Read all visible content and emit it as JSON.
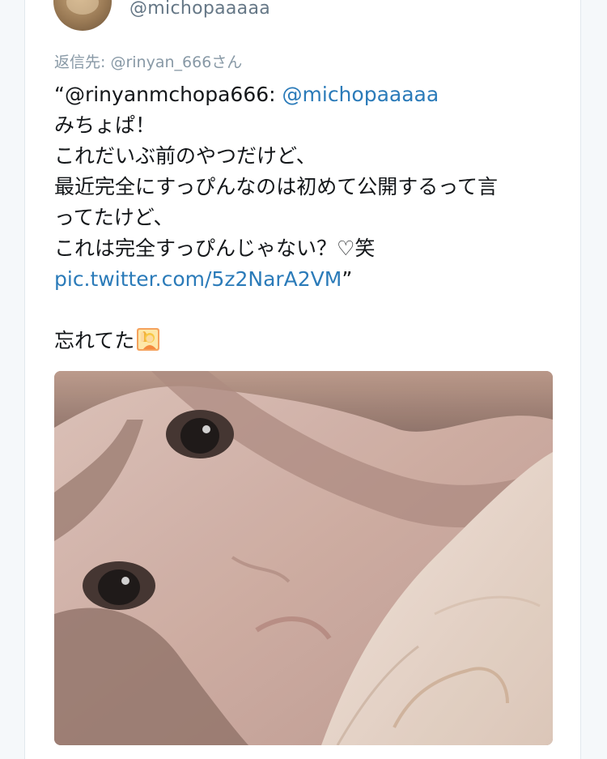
{
  "tweet": {
    "author_handle": "@michopaaaaa",
    "reply_to_label": "返信先:",
    "reply_to_user": "@rinyan_666さん",
    "quote_open": "“@rinyanmchopa666:",
    "quote_mention": "@michopaaaaa",
    "lines": [
      "みちょぱ！",
      "これだいぶ前のやつだけど、",
      "最近完全にすっぴんなのは初めて公開するって言",
      "ってたけど、",
      "これは完全すっぴんじゃない？♡笑"
    ],
    "quote_link": "pic.twitter.com/5z2NarA2VM",
    "quote_close": "”",
    "reply_text": "忘れてた"
  },
  "icons": {
    "avatar": "avatar-photo",
    "emoji": "person-raising-hand-emoji"
  },
  "colors": {
    "link": "#2b7bb9",
    "text": "#14171a",
    "muted": "#8899a6",
    "handle": "#657786"
  }
}
